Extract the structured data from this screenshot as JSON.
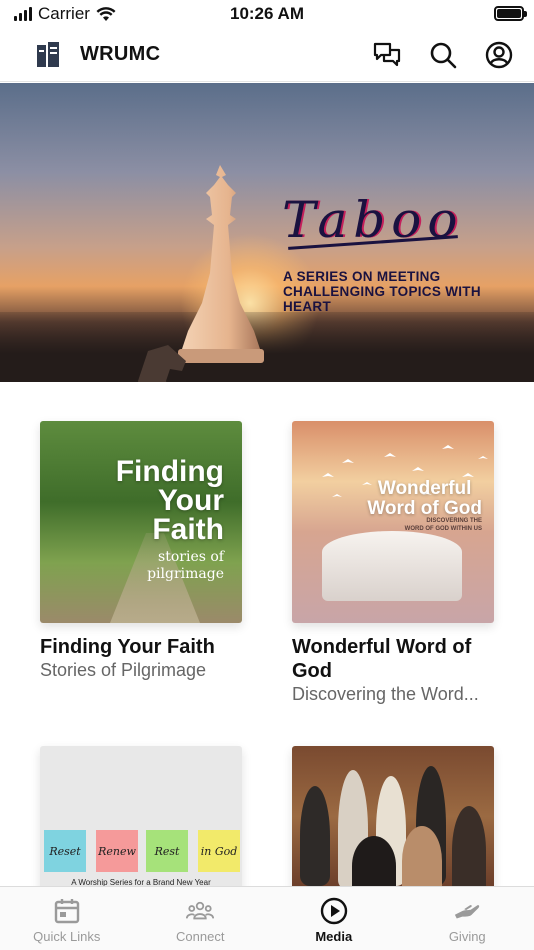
{
  "status_bar": {
    "carrier": "Carrier",
    "time": "10:26 AM"
  },
  "header": {
    "title": "WRUMC",
    "actions": [
      "chat-icon",
      "search-icon",
      "profile-icon"
    ]
  },
  "hero": {
    "title": "Taboo",
    "subtitle": "A SERIES ON MEETING CHALLENGING TOPICS WITH HEART"
  },
  "media": {
    "items": [
      {
        "title": "Finding Your Faith",
        "subtitle": "Stories of Pilgrimage",
        "art_title_lines": [
          "Finding",
          "Your",
          "Faith"
        ],
        "art_caption_lines": [
          "stories of",
          "pilgrimage"
        ]
      },
      {
        "title": "Wonderful Word of God",
        "subtitle": "Discovering the Word...",
        "art_title_lines": [
          "Wonderful",
          "Word of God"
        ],
        "art_caption_lines": [
          "DISCOVERING THE",
          "WORD OF GOD WITHIN US"
        ]
      },
      {
        "art_notes": [
          "Reset",
          "Renew",
          "Rest",
          "in God"
        ],
        "art_caption": "A Worship Series for a Brand New Year"
      },
      {}
    ]
  },
  "tab_bar": {
    "tabs": [
      {
        "label": "Quick Links",
        "icon": "calendar-icon",
        "active": false
      },
      {
        "label": "Connect",
        "icon": "people-icon",
        "active": false
      },
      {
        "label": "Media",
        "icon": "play-icon",
        "active": true
      },
      {
        "label": "Giving",
        "icon": "giving-hand-icon",
        "active": false
      }
    ]
  },
  "colors": {
    "active_tab": "#111111",
    "inactive_tab": "#9a9a9a",
    "hero_title": "#1a1240",
    "hero_accent": "#c41f5a"
  }
}
